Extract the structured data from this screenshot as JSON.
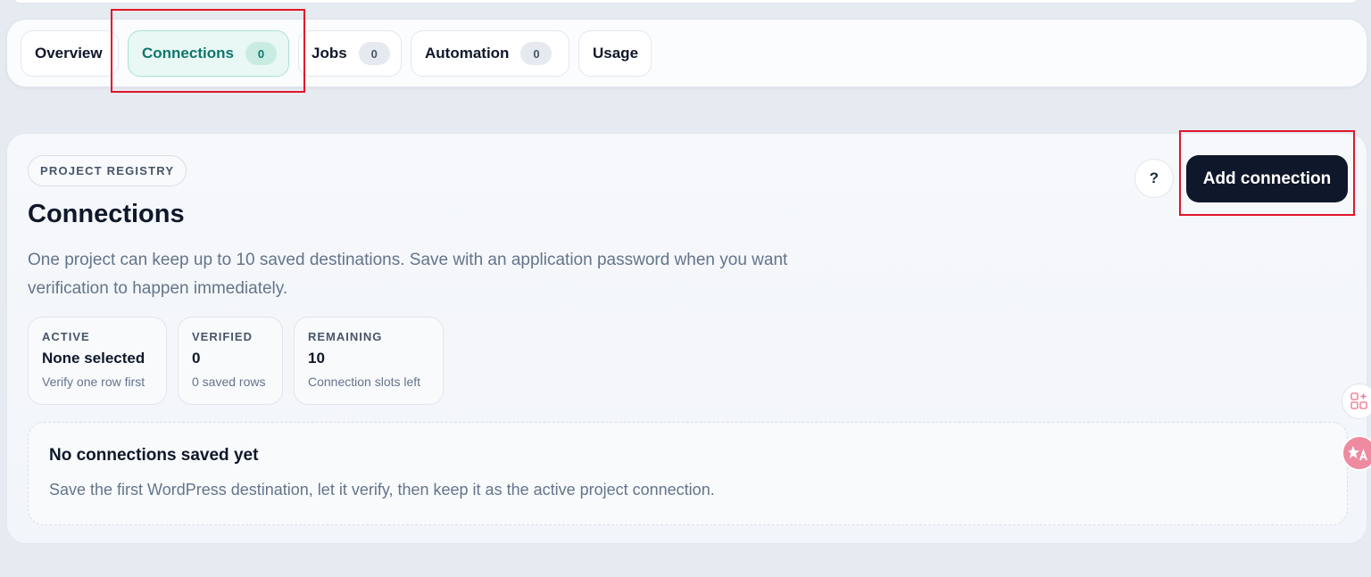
{
  "tabs": {
    "overview": {
      "label": "Overview"
    },
    "connections": {
      "label": "Connections",
      "count": "0"
    },
    "jobs": {
      "label": "Jobs",
      "count": "0"
    },
    "automation": {
      "label": "Automation",
      "count": "0"
    },
    "usage": {
      "label": "Usage"
    },
    "active_tab": "Connections"
  },
  "panel": {
    "eyebrow": "PROJECT REGISTRY",
    "title": "Connections",
    "description": "One project can keep up to 10 saved destinations. Save with an application password when you want verification to happen immediately.",
    "help_label": "?",
    "add_button": "Add connection"
  },
  "stats": [
    {
      "key": "ACTIVE",
      "value": "None selected",
      "sub": "Verify one row first"
    },
    {
      "key": "VERIFIED",
      "value": "0",
      "sub": "0 saved rows"
    },
    {
      "key": "REMAINING",
      "value": "10",
      "sub": "Connection slots left"
    }
  ],
  "empty_state": {
    "title": "No connections saved yet",
    "description": "Save the first WordPress destination, let it verify, then keep it as the active project connection."
  },
  "floating": [
    {
      "icon": "apps-sparkle-icon"
    },
    {
      "icon": "translate-icon"
    }
  ],
  "colors": {
    "accent": "#0f766e",
    "primary_button": "#0f172a",
    "highlight_box": "#e0162b"
  }
}
